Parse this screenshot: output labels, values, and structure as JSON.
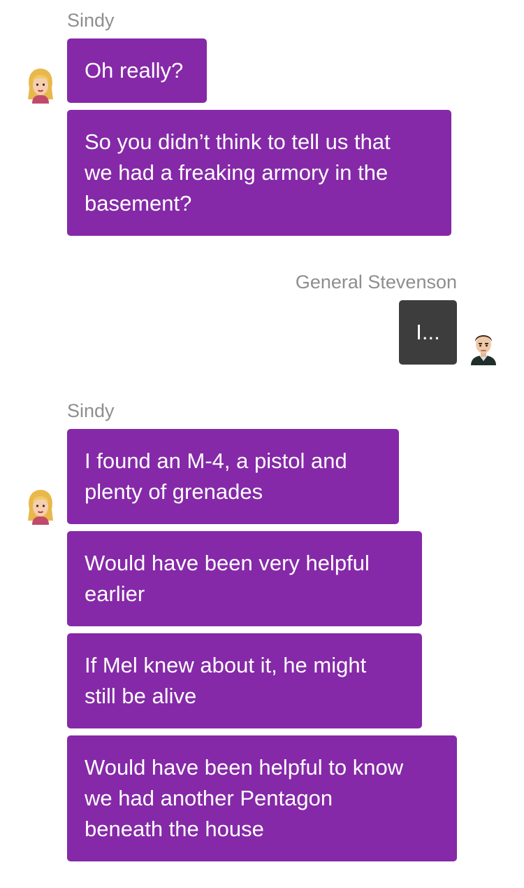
{
  "chat": {
    "group1": {
      "sender": "Sindy",
      "messages": [
        "Oh really?",
        "So you didn’t think to tell us that\nwe had a freaking armory in the\nbasement?"
      ]
    },
    "group2": {
      "sender": "General Stevenson",
      "messages": [
        "I..."
      ]
    },
    "group3": {
      "sender": "Sindy",
      "messages": [
        "I found an M-4, a pistol and\nplenty of grenades",
        "Would have been very helpful\nearlier",
        "If Mel knew about it, he might\nstill be alive",
        "Would have been helpful to know\nwe had another Pentagon\nbeneath the house"
      ]
    }
  },
  "colors": {
    "incoming_bubble": "#8529a8",
    "outgoing_bubble": "#3d3d3d",
    "sender_name": "#8e8e8e"
  },
  "icons": {
    "sindy_avatar": "blonde-woman-avatar-icon",
    "general_avatar": "man-short-hair-avatar-icon"
  }
}
